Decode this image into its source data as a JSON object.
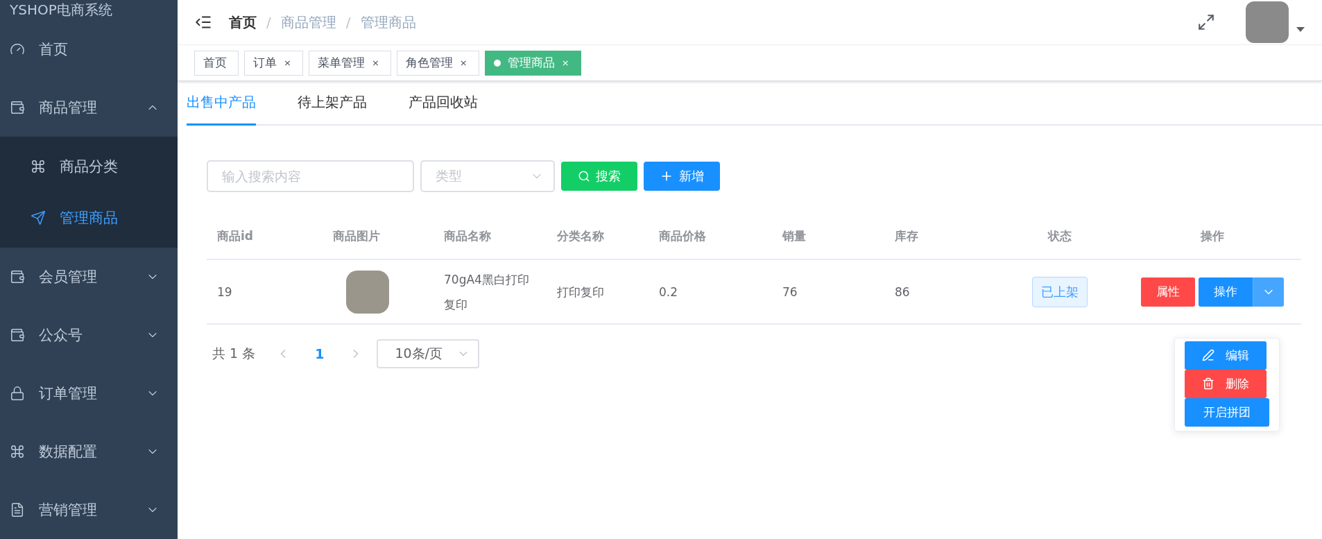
{
  "sidebar": {
    "title": "YSHOP电商系统",
    "items": [
      {
        "label": "首页",
        "kind": "gauge"
      },
      {
        "label": "商品管理",
        "kind": "wallet",
        "expanded": true,
        "children": [
          {
            "label": "商品分类",
            "kind": "clover",
            "selected": false
          },
          {
            "label": "管理商品",
            "kind": "send",
            "selected": true
          }
        ]
      },
      {
        "label": "会员管理",
        "kind": "wallet",
        "expanded": false
      },
      {
        "label": "公众号",
        "kind": "wallet",
        "expanded": false
      },
      {
        "label": "订单管理",
        "kind": "lock",
        "expanded": false
      },
      {
        "label": "数据配置",
        "kind": "clover",
        "expanded": false
      },
      {
        "label": "营销管理",
        "kind": "doc",
        "expanded": false
      }
    ]
  },
  "breadcrumb": [
    "首页",
    "商品管理",
    "管理商品"
  ],
  "breadcrumb_separator": "/",
  "tags": [
    {
      "label": "首页",
      "closable": false,
      "selected": false
    },
    {
      "label": "订单",
      "closable": true,
      "selected": false
    },
    {
      "label": "菜单管理",
      "closable": true,
      "selected": false
    },
    {
      "label": "角色管理",
      "closable": true,
      "selected": false
    },
    {
      "label": "管理商品",
      "closable": true,
      "selected": true
    }
  ],
  "close_mark": "×",
  "tabs": [
    {
      "label": "出售中产品",
      "selected": true
    },
    {
      "label": "待上架产品",
      "selected": false
    },
    {
      "label": "产品回收站",
      "selected": false
    }
  ],
  "search": {
    "placeholder": "输入搜索内容"
  },
  "type_select": {
    "placeholder": "类型"
  },
  "buttons": [
    {
      "label": "搜索",
      "kind": "search"
    },
    {
      "label": "新增",
      "kind": "add"
    }
  ],
  "table": {
    "columns": [
      "商品id",
      "商品图片",
      "商品名称",
      "分类名称",
      "商品价格",
      "销量",
      "库存",
      "状态",
      "操作"
    ],
    "rows": [
      {
        "id": "19",
        "name": "70gA4黑白打印复印",
        "category": "打印复印",
        "price": "0.2",
        "sales": "76",
        "stock": "86",
        "status": "已上架",
        "attr_button": "属性",
        "action_button": "操作"
      }
    ]
  },
  "action_menu": [
    {
      "label": "编辑",
      "kind": "edit"
    },
    {
      "label": "删除",
      "kind": "delete"
    },
    {
      "label": "开启拼团",
      "kind": "group"
    }
  ],
  "pagination": {
    "total": "共 1 条",
    "pages": [
      {
        "label": "1",
        "selected": true
      }
    ],
    "page_size": "10条/页"
  }
}
